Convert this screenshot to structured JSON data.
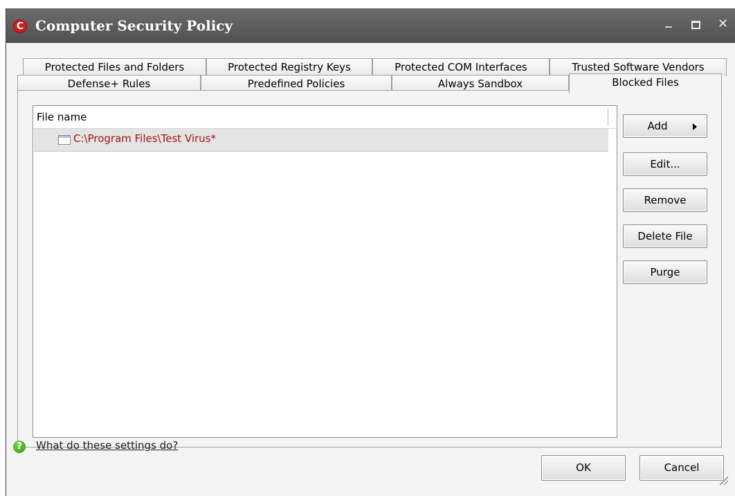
{
  "window": {
    "title": "Computer Security Policy",
    "logo_letter": "C",
    "minimize_label": "–",
    "maximize_label": "□",
    "close_label": "✕"
  },
  "tabs": {
    "row1": [
      "Protected Files and Folders",
      "Protected Registry Keys",
      "Protected COM Interfaces",
      "Trusted Software Vendors"
    ],
    "row2": [
      "Defense+ Rules",
      "Predefined Policies",
      "Always Sandbox",
      "Blocked Files"
    ],
    "active": "Blocked Files"
  },
  "list": {
    "column_header": "File name",
    "rows": [
      "C:\\Program Files\\Test Virus*"
    ]
  },
  "actions": {
    "add": "Add",
    "edit": "Edit...",
    "remove": "Remove",
    "delete_file": "Delete File",
    "purge": "Purge"
  },
  "footer": {
    "help_glyph": "?",
    "help_link": "What do these settings do?",
    "ok": "OK",
    "cancel": "Cancel"
  },
  "colors": {
    "titlebar": "#5e5e5e",
    "file_text": "#a11616",
    "logo": "#cf1d1d"
  },
  "icons": [
    "app-logo-icon",
    "file-icon",
    "help-icon",
    "chevron-right-icon"
  ]
}
